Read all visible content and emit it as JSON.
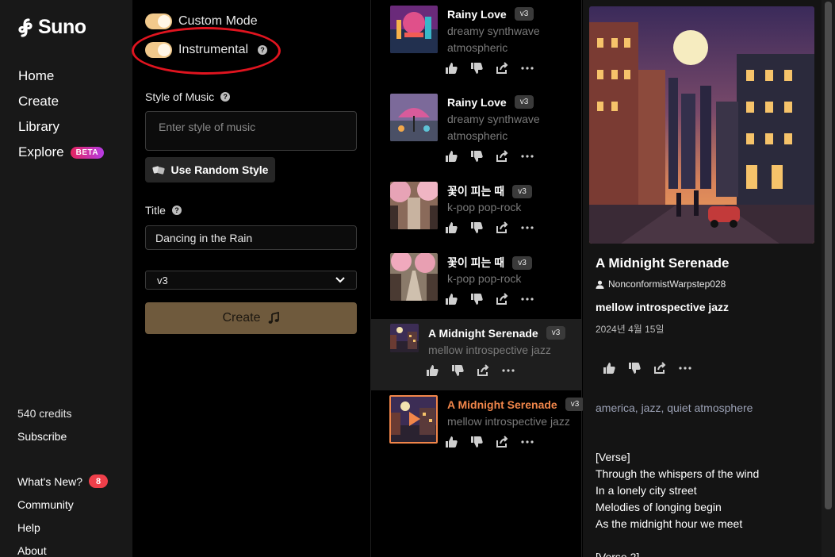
{
  "sidebar": {
    "brand": "Suno",
    "nav": [
      {
        "label": "Home"
      },
      {
        "label": "Create"
      },
      {
        "label": "Library"
      },
      {
        "label": "Explore",
        "badge": "BETA"
      }
    ],
    "credits": "540 credits",
    "subscribe": "Subscribe",
    "footer": [
      {
        "label": "What's New?",
        "badge": "8"
      },
      {
        "label": "Community"
      },
      {
        "label": "Help"
      },
      {
        "label": "About"
      }
    ]
  },
  "form": {
    "custom_mode_label": "Custom Mode",
    "custom_mode_on": true,
    "instrumental_label": "Instrumental",
    "instrumental_on": true,
    "style_label": "Style of Music",
    "style_placeholder": "Enter style of music",
    "random_style_label": "Use Random Style",
    "title_label": "Title",
    "title_value": "Dancing in the Rain",
    "model_value": "v3",
    "create_label": "Create"
  },
  "songs": [
    {
      "title": "Rainy Love",
      "version": "v3",
      "tags": [
        "dreamy synthwave",
        "atmospheric"
      ]
    },
    {
      "title": "Rainy Love",
      "version": "v3",
      "tags": [
        "dreamy synthwave",
        "atmospheric"
      ]
    },
    {
      "title": "꽃이 피는 때",
      "version": "v3",
      "tags": [
        "k-pop pop-rock"
      ]
    },
    {
      "title": "꽃이 피는 때",
      "version": "v3",
      "tags": [
        "k-pop pop-rock"
      ]
    },
    {
      "title": "A Midnight Serenade",
      "version": "v3",
      "tags": [
        "mellow introspective jazz"
      ]
    },
    {
      "title": "A Midnight Serenade",
      "version": "v3",
      "tags": [
        "mellow introspective jazz"
      ]
    }
  ],
  "detail": {
    "title": "A Midnight Serenade",
    "author": "NonconformistWarpstep028",
    "style": "mellow introspective jazz",
    "date": "2024년 4월 15일",
    "tags": "america, jazz, quiet atmosphere",
    "lyrics": "[Verse]\nThrough the whispers of the wind\nIn a lonely city street\nMelodies of longing begin\nAs the midnight hour we meet\n\n[Verse 2]"
  },
  "colors": {
    "accent": "#f1864a",
    "toggle": "#f1c98c",
    "create_button": "#6f5a3d",
    "highlight_ring": "#e0141f"
  }
}
